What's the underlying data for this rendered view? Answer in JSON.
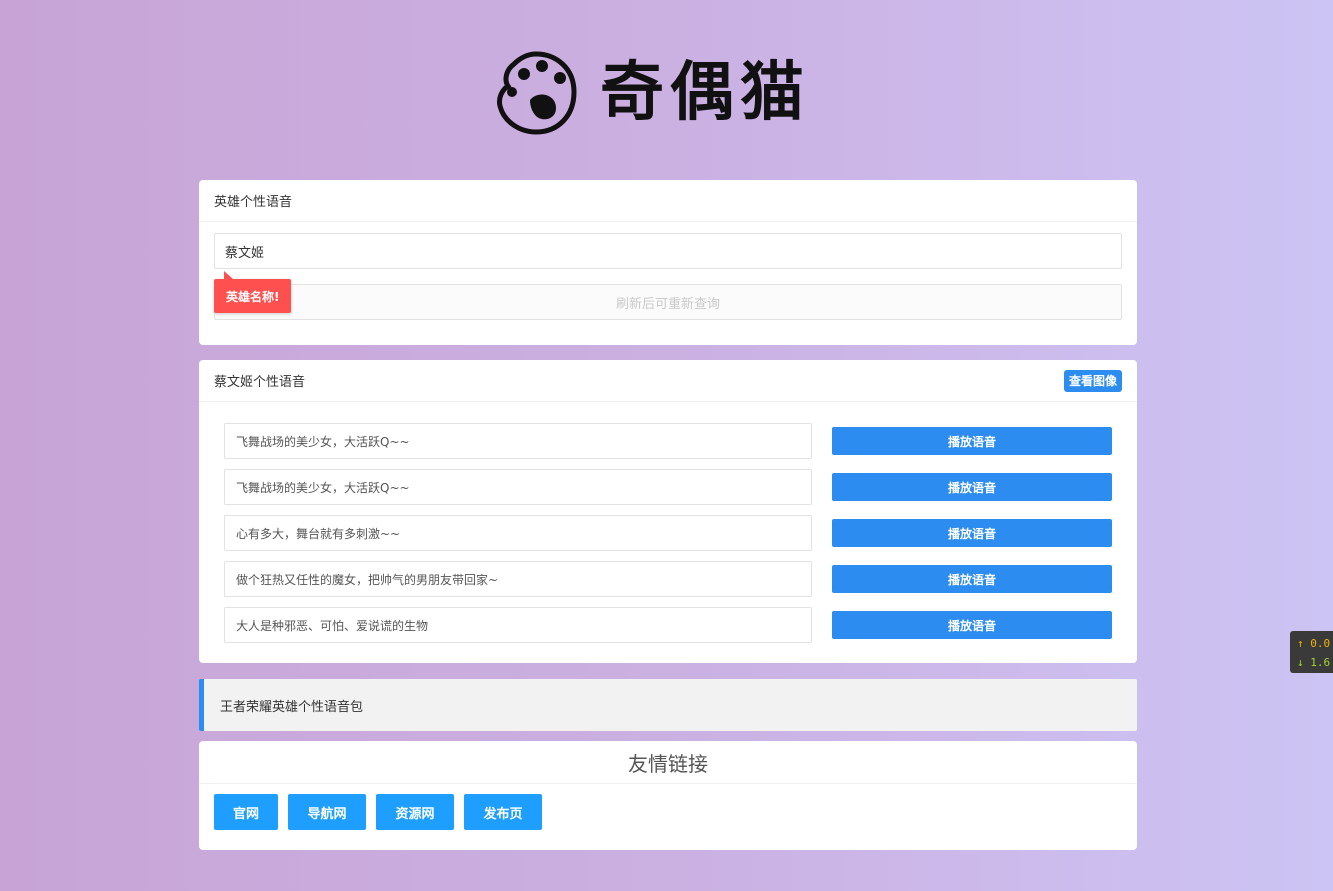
{
  "logo": {
    "text": "奇偶猫"
  },
  "search_card": {
    "title": "英雄个性语音",
    "input_value": "蔡文姬",
    "tip": "英雄名称!",
    "refresh_button": "刷新后可重新查询"
  },
  "result_card": {
    "title": "蔡文姬个性语音",
    "view_image_button": "查看图像",
    "voices": [
      {
        "text": "飞舞战场的美少女，大活跃Q~~",
        "button": "播放语音"
      },
      {
        "text": "飞舞战场的美少女，大活跃Q~~",
        "button": "播放语音"
      },
      {
        "text": "心有多大，舞台就有多刺激~~",
        "button": "播放语音"
      },
      {
        "text": "做个狂热又任性的魔女，把帅气的男朋友带回家~",
        "button": "播放语音"
      },
      {
        "text": "大人是种邪恶、可怕、爱说谎的生物",
        "button": "播放语音"
      }
    ]
  },
  "info_quote": "王者荣耀英雄个性语音包",
  "links_card": {
    "title": "友情链接",
    "links": [
      "官网",
      "导航网",
      "资源网",
      "发布页"
    ]
  },
  "speed_widget": {
    "up": "↑ 0.0",
    "down": "↓ 1.6"
  },
  "colors": {
    "primary": "#2d8cf0",
    "link_button": "#1e9fff",
    "tip": "#ff5050"
  }
}
